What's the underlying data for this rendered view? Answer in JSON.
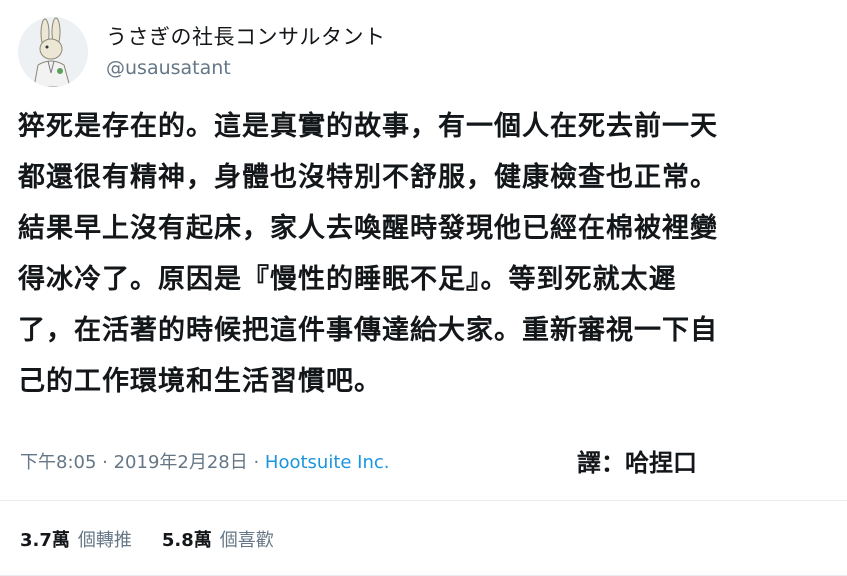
{
  "author": {
    "display_name": "うさぎの社長コンサルタント",
    "handle": "@usausatant",
    "avatar_icon": "rabbit-avatar-icon"
  },
  "tweet": {
    "lines": [
      "猝死是存在的。這是真實的故事，有一個人在死去前一天",
      "都還很有精神，身體也沒特別不舒服，健康檢查也正常。",
      "結果早上沒有起床，家人去喚醒時發現他已經在棉被裡變",
      "得冰冷了。原因是『慢性的睡眠不足』。等到死就太遲",
      "了，在活著的時候把這件事傳達給大家。重新審視一下自",
      "己的工作環境和生活習慣吧。"
    ]
  },
  "meta": {
    "time": "下午8:05 · 2019年2月28日 · ",
    "source": "Hootsuite Inc.",
    "translator": "譯：哈捏口"
  },
  "stats": {
    "retweets_count": "3.7萬",
    "retweets_label": "個轉推",
    "likes_count": "5.8萬",
    "likes_label": "個喜歡"
  },
  "colors": {
    "text": "#14171a",
    "secondary": "#657786",
    "link": "#1b95e0",
    "divider": "#e6ecf0"
  }
}
